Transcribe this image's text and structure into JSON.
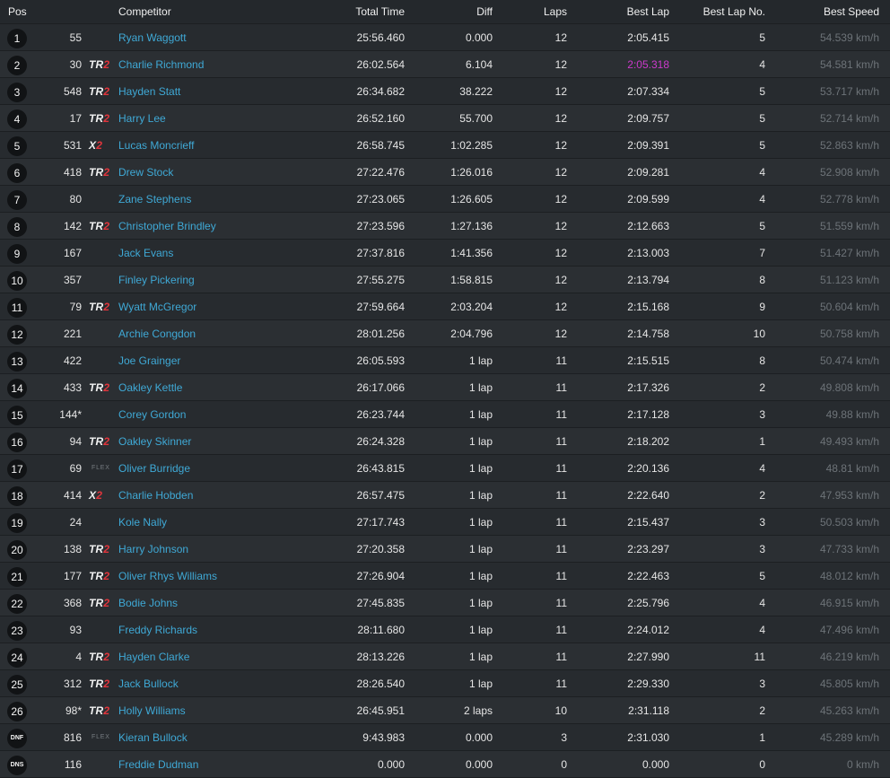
{
  "header": {
    "pos": "Pos",
    "competitor": "Competitor",
    "total_time": "Total Time",
    "diff": "Diff",
    "laps": "Laps",
    "best_lap": "Best Lap",
    "best_lap_no": "Best Lap No.",
    "best_speed": "Best Speed"
  },
  "colors": {
    "name": "#3fa9d6",
    "fastest_lap": "#cc3acc",
    "class_accent": "#e0353c",
    "speed": "#6d7378"
  },
  "rows": [
    {
      "pos": "1",
      "no": "55",
      "cls": "",
      "name": "Ryan Waggott",
      "total": "25:56.460",
      "diff": "0.000",
      "laps": "12",
      "best": "2:05.415",
      "bestno": "5",
      "speed": "54.539 km/h"
    },
    {
      "pos": "2",
      "no": "30",
      "cls": "TR2",
      "name": "Charlie Richmond",
      "total": "26:02.564",
      "diff": "6.104",
      "laps": "12",
      "best": "2:05.318",
      "bestno": "4",
      "speed": "54.581 km/h",
      "fastest": true
    },
    {
      "pos": "3",
      "no": "548",
      "cls": "TR2",
      "name": "Hayden Statt",
      "total": "26:34.682",
      "diff": "38.222",
      "laps": "12",
      "best": "2:07.334",
      "bestno": "5",
      "speed": "53.717 km/h"
    },
    {
      "pos": "4",
      "no": "17",
      "cls": "TR2",
      "name": "Harry Lee",
      "total": "26:52.160",
      "diff": "55.700",
      "laps": "12",
      "best": "2:09.757",
      "bestno": "5",
      "speed": "52.714 km/h"
    },
    {
      "pos": "5",
      "no": "531",
      "cls": "X2",
      "name": "Lucas Moncrieff",
      "total": "26:58.745",
      "diff": "1:02.285",
      "laps": "12",
      "best": "2:09.391",
      "bestno": "5",
      "speed": "52.863 km/h"
    },
    {
      "pos": "6",
      "no": "418",
      "cls": "TR2",
      "name": "Drew Stock",
      "total": "27:22.476",
      "diff": "1:26.016",
      "laps": "12",
      "best": "2:09.281",
      "bestno": "4",
      "speed": "52.908 km/h"
    },
    {
      "pos": "7",
      "no": "80",
      "cls": "",
      "name": "Zane Stephens",
      "total": "27:23.065",
      "diff": "1:26.605",
      "laps": "12",
      "best": "2:09.599",
      "bestno": "4",
      "speed": "52.778 km/h"
    },
    {
      "pos": "8",
      "no": "142",
      "cls": "TR2",
      "name": "Christopher Brindley",
      "total": "27:23.596",
      "diff": "1:27.136",
      "laps": "12",
      "best": "2:12.663",
      "bestno": "5",
      "speed": "51.559 km/h"
    },
    {
      "pos": "9",
      "no": "167",
      "cls": "",
      "name": "Jack Evans",
      "total": "27:37.816",
      "diff": "1:41.356",
      "laps": "12",
      "best": "2:13.003",
      "bestno": "7",
      "speed": "51.427 km/h"
    },
    {
      "pos": "10",
      "no": "357",
      "cls": "",
      "name": "Finley Pickering",
      "total": "27:55.275",
      "diff": "1:58.815",
      "laps": "12",
      "best": "2:13.794",
      "bestno": "8",
      "speed": "51.123 km/h"
    },
    {
      "pos": "11",
      "no": "79",
      "cls": "TR2",
      "name": "Wyatt McGregor",
      "total": "27:59.664",
      "diff": "2:03.204",
      "laps": "12",
      "best": "2:15.168",
      "bestno": "9",
      "speed": "50.604 km/h"
    },
    {
      "pos": "12",
      "no": "221",
      "cls": "",
      "name": "Archie Congdon",
      "total": "28:01.256",
      "diff": "2:04.796",
      "laps": "12",
      "best": "2:14.758",
      "bestno": "10",
      "speed": "50.758 km/h"
    },
    {
      "pos": "13",
      "no": "422",
      "cls": "",
      "name": "Joe Grainger",
      "total": "26:05.593",
      "diff": "1 lap",
      "laps": "11",
      "best": "2:15.515",
      "bestno": "8",
      "speed": "50.474 km/h"
    },
    {
      "pos": "14",
      "no": "433",
      "cls": "TR2",
      "name": "Oakley Kettle",
      "total": "26:17.066",
      "diff": "1 lap",
      "laps": "11",
      "best": "2:17.326",
      "bestno": "2",
      "speed": "49.808 km/h"
    },
    {
      "pos": "15",
      "no": "144*",
      "cls": "",
      "name": "Corey Gordon",
      "total": "26:23.744",
      "diff": "1 lap",
      "laps": "11",
      "best": "2:17.128",
      "bestno": "3",
      "speed": "49.88 km/h"
    },
    {
      "pos": "16",
      "no": "94",
      "cls": "TR2",
      "name": "Oakley Skinner",
      "total": "26:24.328",
      "diff": "1 lap",
      "laps": "11",
      "best": "2:18.202",
      "bestno": "1",
      "speed": "49.493 km/h"
    },
    {
      "pos": "17",
      "no": "69",
      "cls": "FLEX",
      "name": "Oliver Burridge",
      "total": "26:43.815",
      "diff": "1 lap",
      "laps": "11",
      "best": "2:20.136",
      "bestno": "4",
      "speed": "48.81 km/h"
    },
    {
      "pos": "18",
      "no": "414",
      "cls": "X2",
      "name": "Charlie Hobden",
      "total": "26:57.475",
      "diff": "1 lap",
      "laps": "11",
      "best": "2:22.640",
      "bestno": "2",
      "speed": "47.953 km/h"
    },
    {
      "pos": "19",
      "no": "24",
      "cls": "",
      "name": "Kole Nally",
      "total": "27:17.743",
      "diff": "1 lap",
      "laps": "11",
      "best": "2:15.437",
      "bestno": "3",
      "speed": "50.503 km/h"
    },
    {
      "pos": "20",
      "no": "138",
      "cls": "TR2",
      "name": "Harry Johnson",
      "total": "27:20.358",
      "diff": "1 lap",
      "laps": "11",
      "best": "2:23.297",
      "bestno": "3",
      "speed": "47.733 km/h"
    },
    {
      "pos": "21",
      "no": "177",
      "cls": "TR2",
      "name": "Oliver Rhys Williams",
      "total": "27:26.904",
      "diff": "1 lap",
      "laps": "11",
      "best": "2:22.463",
      "bestno": "5",
      "speed": "48.012 km/h"
    },
    {
      "pos": "22",
      "no": "368",
      "cls": "TR2",
      "name": "Bodie Johns",
      "total": "27:45.835",
      "diff": "1 lap",
      "laps": "11",
      "best": "2:25.796",
      "bestno": "4",
      "speed": "46.915 km/h"
    },
    {
      "pos": "23",
      "no": "93",
      "cls": "",
      "name": "Freddy Richards",
      "total": "28:11.680",
      "diff": "1 lap",
      "laps": "11",
      "best": "2:24.012",
      "bestno": "4",
      "speed": "47.496 km/h"
    },
    {
      "pos": "24",
      "no": "4",
      "cls": "TR2",
      "name": "Hayden Clarke",
      "total": "28:13.226",
      "diff": "1 lap",
      "laps": "11",
      "best": "2:27.990",
      "bestno": "11",
      "speed": "46.219 km/h"
    },
    {
      "pos": "25",
      "no": "312",
      "cls": "TR2",
      "name": "Jack Bullock",
      "total": "28:26.540",
      "diff": "1 lap",
      "laps": "11",
      "best": "2:29.330",
      "bestno": "3",
      "speed": "45.805 km/h"
    },
    {
      "pos": "26",
      "no": "98*",
      "cls": "TR2",
      "name": "Holly Williams",
      "total": "26:45.951",
      "diff": "2 laps",
      "laps": "10",
      "best": "2:31.118",
      "bestno": "2",
      "speed": "45.263 km/h"
    },
    {
      "pos": "DNF",
      "no": "816",
      "cls": "FLEX",
      "name": "Kieran Bullock",
      "total": "9:43.983",
      "diff": "0.000",
      "laps": "3",
      "best": "2:31.030",
      "bestno": "1",
      "speed": "45.289 km/h"
    },
    {
      "pos": "DNS",
      "no": "116",
      "cls": "",
      "name": "Freddie Dudman",
      "total": "0.000",
      "diff": "0.000",
      "laps": "0",
      "best": "0.000",
      "bestno": "0",
      "speed": "0 km/h"
    }
  ]
}
